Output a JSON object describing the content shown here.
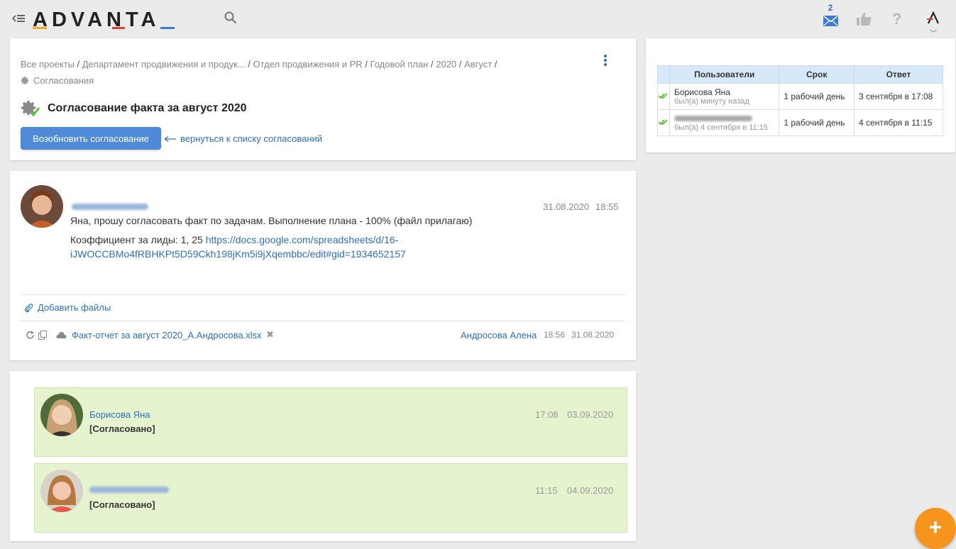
{
  "header": {
    "logo": "ADVANTA",
    "mail_count": "2",
    "help": "?"
  },
  "breadcrumb": {
    "items": [
      "Все проекты",
      "Департамент продвижения и продук...",
      "Отдел продвижения и PR",
      "Годовой план",
      "2020",
      "Август"
    ],
    "separator": "/",
    "current": "Согласования"
  },
  "page": {
    "title": "Согласование факта за август 2020",
    "resume_button": "Возобновить согласование",
    "back_link": "вернуться к списку согласований"
  },
  "message": {
    "time": "18:55",
    "date": "31.08.2020",
    "text": "Яна, прошу согласовать факт по задачам. Выполнение плана - 100% (файл прилагаю)",
    "coef_label": "Коэффициент за лиды: 1, 25",
    "link_part1": "https://docs.google.com/spreadsheets/d/16-",
    "link_part2": "iJWOCCBMo4fRBHKPt5D59Ckh198jKm5i9jXqembbc/edit#gid=1934652157",
    "add_files": "Добавить файлы",
    "file": {
      "name": "Факт-отчет за август 2020_А.Андросова.xlsx",
      "author": "Андросова Алена",
      "time": "18:56",
      "date": "31.08.2020"
    }
  },
  "approvals": [
    {
      "name": "Борисова Яна",
      "status": "[Согласовано]",
      "time": "17:08",
      "date": "03.09.2020"
    },
    {
      "name": "",
      "status": "[Согласовано]",
      "time": "11:15",
      "date": "04.09.2020"
    }
  ],
  "users_table": {
    "headers": [
      "Пользователи",
      "Срок",
      "Ответ"
    ],
    "rows": [
      {
        "name": "Борисова Яна",
        "seen": "был(а) минуту назад",
        "term": "1 рабочий день",
        "answer": "3 сентября в 17:08"
      },
      {
        "name": "",
        "seen": "был(а) 4 сентября в 11:15",
        "term": "1 рабочий день",
        "answer": "4 сентября в 11:15"
      }
    ]
  },
  "fab": "+",
  "colors": {
    "accent_blue": "#4f8ad6",
    "link": "#2d6fb8",
    "approved_bg": "#e6f3cf",
    "fab": "#f7941d",
    "table_header": "#d8e8fb"
  }
}
